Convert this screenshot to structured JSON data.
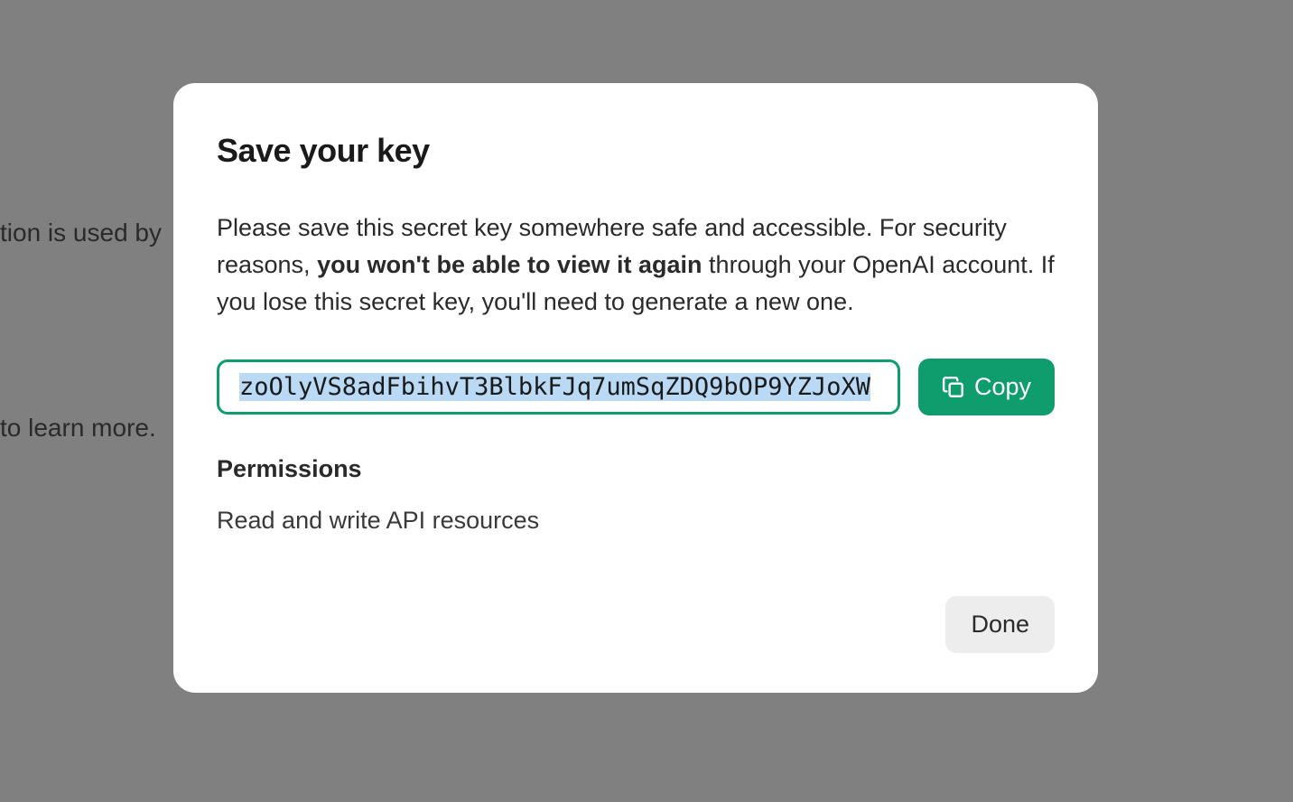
{
  "background": {
    "line1": "tion is used by",
    "line2": " to learn more."
  },
  "modal": {
    "title": "Save your key",
    "description": {
      "prefix": "Please save this secret key somewhere safe and accessible. For security reasons, ",
      "bold": "you won't be able to view it again",
      "suffix": " through your OpenAI account. If you lose this secret key, you'll need to generate a new one."
    },
    "key_value": "zoOlyVS8adFbihvT3BlbkFJq7umSqZDQ9bOP9YZJoXW",
    "copy_label": "Copy",
    "permissions_heading": "Permissions",
    "permissions_text": "Read and write API resources",
    "done_label": "Done"
  },
  "colors": {
    "accent": "#0f9d6d",
    "selection": "#b9d9f4",
    "backdrop": "#808080"
  }
}
